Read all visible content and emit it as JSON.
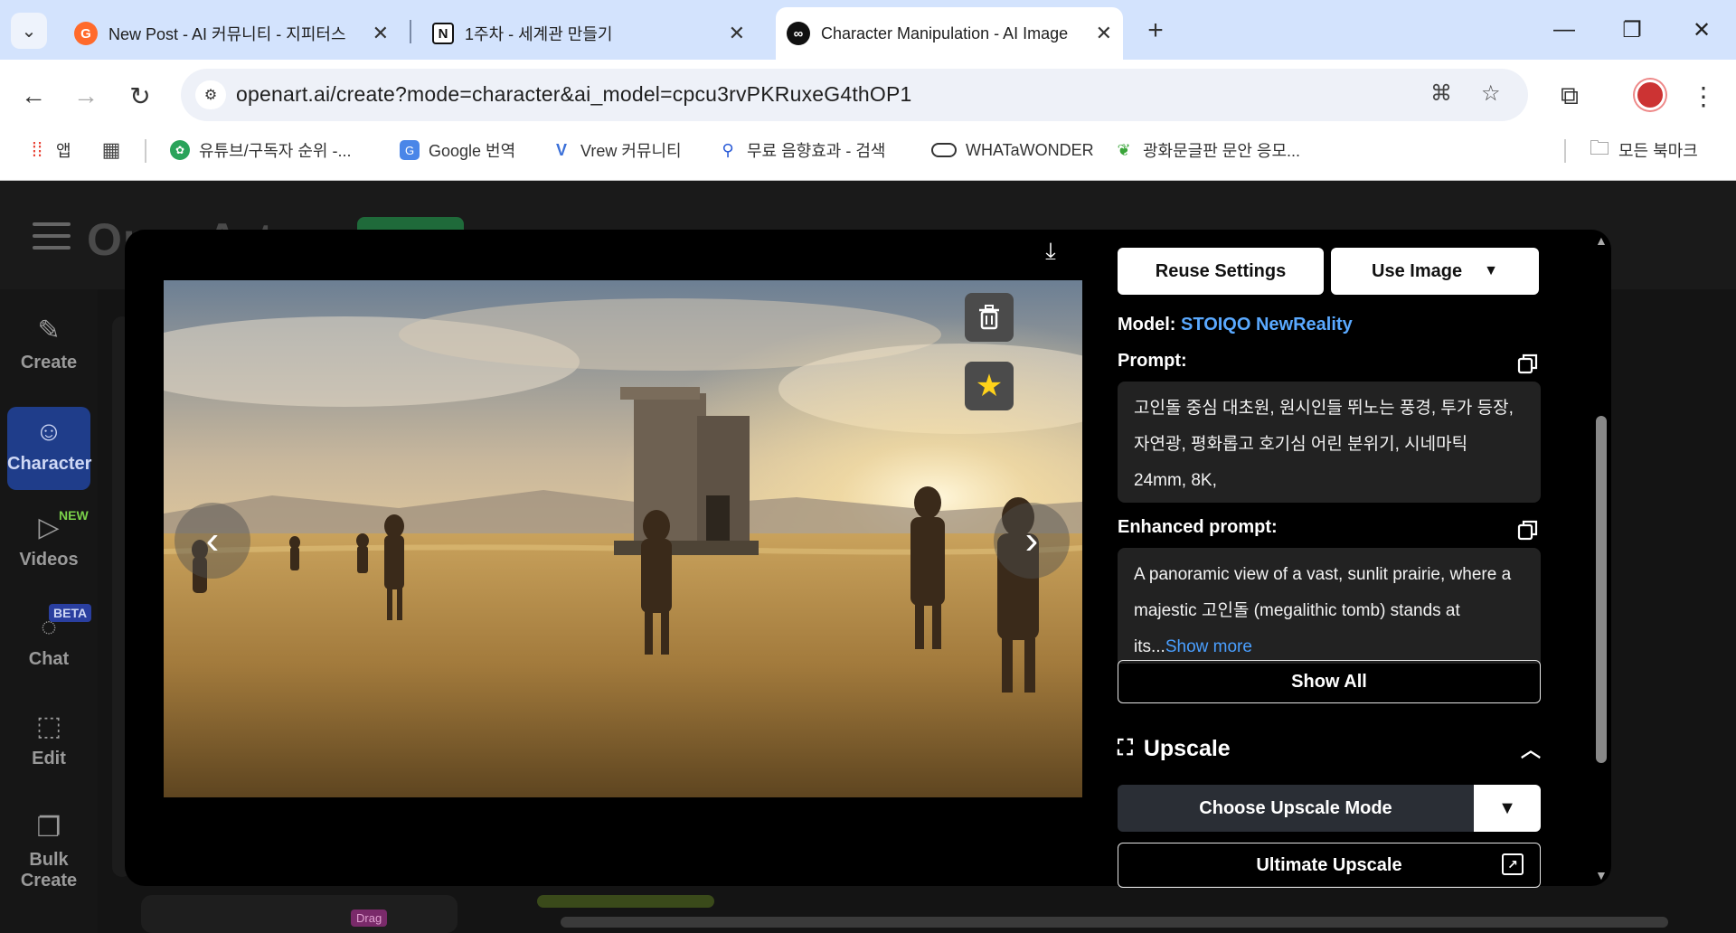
{
  "browser": {
    "tabs": [
      {
        "title": "New Post - AI 커뮤니티 - 지피터스",
        "active": false,
        "favicon_color": "#ff6a2b",
        "favicon_glyph": "G"
      },
      {
        "title": "1주차 - 세계관 만들기",
        "active": false,
        "favicon_color": "#ffffff",
        "favicon_glyph": "N"
      },
      {
        "title": "Character Manipulation - AI Image",
        "active": true,
        "favicon_color": "#111111",
        "favicon_glyph": "∞"
      }
    ],
    "new_tab_glyph": "+",
    "url": "openart.ai/create?mode=character&ai_model=cpcu3rvPKRuxeG4thOP1",
    "bookmarks": [
      {
        "label": "앱",
        "icon": "apps-grid-icon"
      },
      {
        "label": "",
        "icon": "grid-icon"
      },
      {
        "label": "유튜브/구독자 순위 -...",
        "icon": "green-logo-icon"
      },
      {
        "label": "Google 번역",
        "icon": "google-translate-icon"
      },
      {
        "label": "Vrew 커뮤니티",
        "icon": "vrew-icon"
      },
      {
        "label": "무료 음향효과 - 검색",
        "icon": "search-icon"
      },
      {
        "label": "WHATaWONDER",
        "icon": "pill-icon"
      },
      {
        "label": "광화문글판 문안 응모...",
        "icon": "leaf-icon"
      },
      {
        "label": "모든 북마크",
        "icon": "folder-icon"
      }
    ]
  },
  "app": {
    "logo": "OpenArt",
    "sidebar": [
      {
        "label": "Create",
        "icon": "create-icon",
        "active": false
      },
      {
        "label": "Character",
        "icon": "character-icon",
        "active": true
      },
      {
        "label": "Videos",
        "icon": "video-icon",
        "active": false,
        "badge": "NEW"
      },
      {
        "label": "Chat",
        "icon": "chat-icon",
        "active": false,
        "badge": "BETA"
      },
      {
        "label": "Edit",
        "icon": "edit-icon",
        "active": false
      },
      {
        "label": "Bulk Create",
        "icon": "bulk-create-icon",
        "active": false
      }
    ],
    "bg_labels": {
      "drag": "Drag"
    }
  },
  "modal": {
    "reuse_settings": "Reuse Settings",
    "use_image": "Use Image",
    "model_label": "Model:",
    "model_value": "STOIQO NewReality",
    "prompt_label": "Prompt:",
    "prompt_text": "고인돌 중심 대초원, 원시인들 뛰노는 풍경, 투가 등장, 자연광, 평화롭고 호기심 어린 분위기, 시네마틱 24mm, 8K,",
    "enhanced_label": "Enhanced prompt:",
    "enhanced_text": "A panoramic view of a vast, sunlit prairie, where a majestic 고인돌 (megalithic tomb) stands at its...",
    "show_more": "Show more",
    "show_all": "Show All",
    "upscale_title": "Upscale",
    "choose_upscale": "Choose Upscale Mode",
    "ultimate_upscale": "Ultimate Upscale"
  },
  "colors": {
    "accent_blue": "#5aa9ff",
    "active_nav": "#1f3d8a",
    "tabbar": "#d3e3fd"
  }
}
